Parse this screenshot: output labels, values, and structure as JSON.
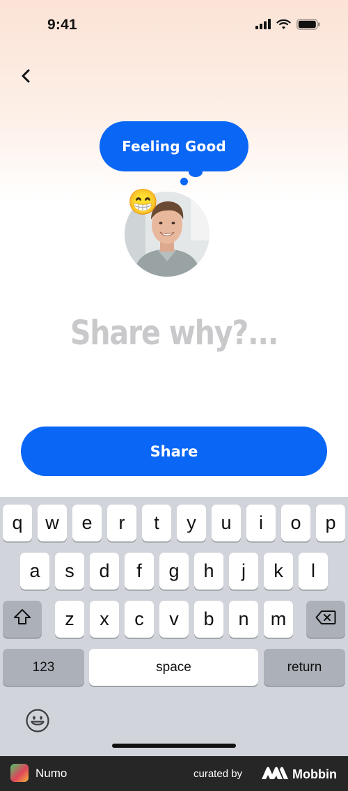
{
  "status_bar": {
    "time": "9:41"
  },
  "mood": {
    "label": "Feeling Good",
    "emoji": "😁"
  },
  "prompt": {
    "text": "Share why?..."
  },
  "actions": {
    "share_label": "Share"
  },
  "keyboard": {
    "row1": [
      "q",
      "w",
      "e",
      "r",
      "t",
      "y",
      "u",
      "i",
      "o",
      "p"
    ],
    "row2": [
      "a",
      "s",
      "d",
      "f",
      "g",
      "h",
      "j",
      "k",
      "l"
    ],
    "row3": [
      "z",
      "x",
      "c",
      "v",
      "b",
      "n",
      "m"
    ],
    "numbers_label": "123",
    "space_label": "space",
    "return_label": "return"
  },
  "footer": {
    "app_name": "Numo",
    "curated_by": "curated by",
    "brand": "Mobbin"
  },
  "colors": {
    "accent": "#0a66f5",
    "prompt_text": "#c9c9cc",
    "keyboard_bg": "#d1d4da"
  }
}
